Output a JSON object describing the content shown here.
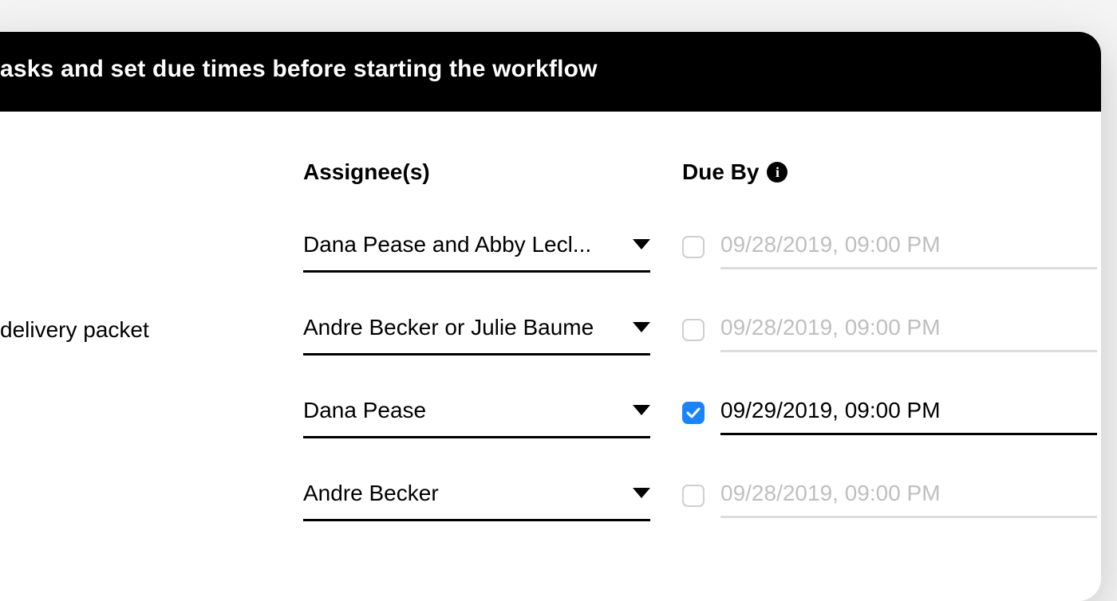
{
  "header": {
    "title_fragment": "asks and set due times before starting the workflow"
  },
  "columns": {
    "assignee": "Assignee(s)",
    "due_by": "Due By"
  },
  "rows": [
    {
      "task_label": "",
      "assignee": "Dana Pease and Abby Lecl...",
      "due_checked": false,
      "due_value": "09/28/2019, 09:00 PM"
    },
    {
      "task_label": "delivery packet",
      "assignee": "Andre Becker or Julie Baume",
      "due_checked": false,
      "due_value": "09/28/2019, 09:00 PM"
    },
    {
      "task_label": "",
      "assignee": "Dana Pease",
      "due_checked": true,
      "due_value": "09/29/2019, 09:00 PM"
    },
    {
      "task_label": "",
      "assignee": "Andre Becker",
      "due_checked": false,
      "due_value": "09/28/2019, 09:00 PM"
    }
  ],
  "icons": {
    "info": "i"
  }
}
